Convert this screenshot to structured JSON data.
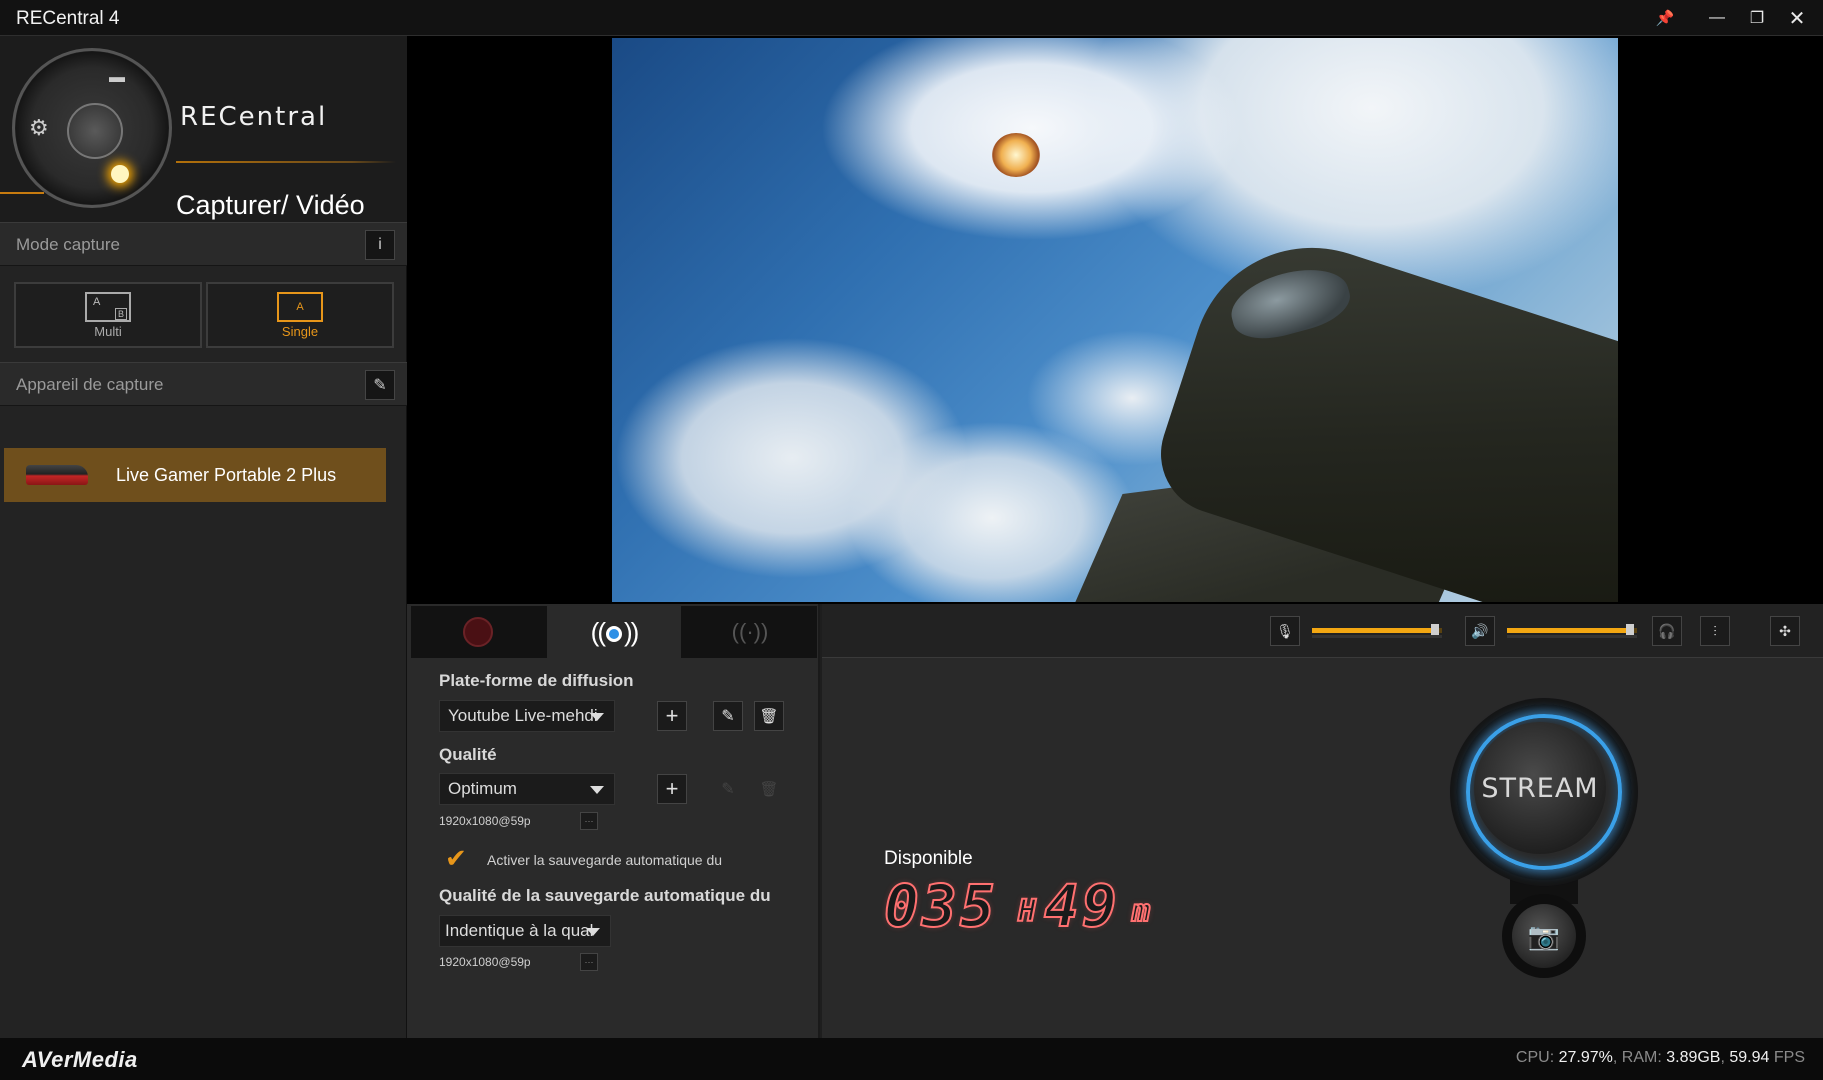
{
  "window": {
    "title": "RECentral 4"
  },
  "titlebar": {
    "pin": "📌",
    "minimize": "—",
    "restore": "❐",
    "close": "✕"
  },
  "brand": {
    "name": "RECentral",
    "mode_title": "Capturer/ Vidéo"
  },
  "capture_mode": {
    "header": "Mode capture",
    "info_btn": "i",
    "options": [
      {
        "label": "Multi",
        "icon_a": "A",
        "icon_b": "B"
      },
      {
        "label": "Single",
        "icon_a": "A"
      }
    ]
  },
  "capture_device": {
    "header": "Appareil de capture",
    "edit_btn": "✎",
    "selected": "Live Gamer Portable 2 Plus"
  },
  "tabs": {
    "record": "record-tab",
    "stream": "((●))",
    "network": "((·))"
  },
  "stream_settings": {
    "platform_label": "Plate-forme de diffusion",
    "platform_value": "Youtube Live-mehdi",
    "quality_label": "Qualité",
    "quality_value": "Optimum",
    "quality_res": "1920x1080@59p",
    "autosave_label": "Activer la sauvegarde automatique du",
    "autosave_checked": true,
    "autosave_quality_label": "Qualité de la sauvegarde automatique du",
    "autosave_quality_value": "Indentique à la qual",
    "autosave_res": "1920x1080@59p",
    "add": "+",
    "edit": "✎",
    "delete": "🗑",
    "more": "···"
  },
  "audio": {
    "mic_level": 0.98,
    "speaker_level": 0.98,
    "mic_icon": "mic-icon",
    "speaker_icon": "speaker-icon",
    "headphone_icon": "headphone-icon",
    "mixer_icon": "mixer-icon",
    "fullscreen_icon": "fullscreen-icon"
  },
  "availability": {
    "label": "Disponible",
    "hours": "035",
    "hours_unit": "H",
    "minutes": "49",
    "minutes_unit": "m"
  },
  "stream_button": {
    "label": "STREAM",
    "snapshot_icon": "camera-icon"
  },
  "footer": {
    "logo": "AVerMedia",
    "cpu_label": "CPU:",
    "cpu": "27.97%",
    "ram_label": ", RAM:",
    "ram": "3.89GB",
    "fps": "59.94",
    "fps_label": "FPS"
  },
  "colors": {
    "accent": "#e7961a",
    "stream_ring": "#3aa0e8",
    "segment": "#ff7070",
    "device_bg": "#6f4f1c"
  }
}
